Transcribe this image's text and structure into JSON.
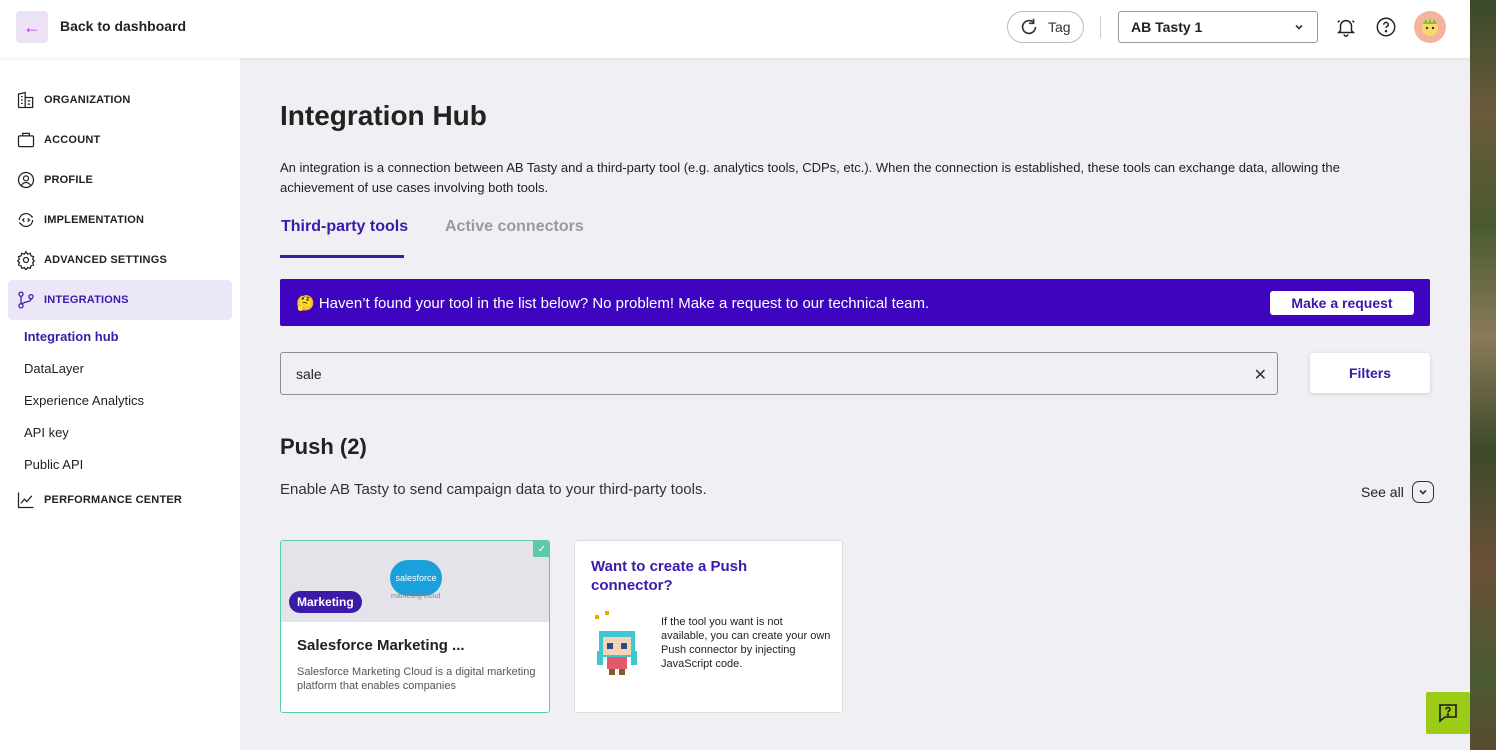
{
  "topbar": {
    "back_label": "Back to dashboard",
    "tag_label": "Tag",
    "account_name": "AB Tasty 1"
  },
  "sidebar": {
    "items": [
      {
        "label": "ORGANIZATION",
        "icon": "building-icon"
      },
      {
        "label": "ACCOUNT",
        "icon": "briefcase-icon"
      },
      {
        "label": "PROFILE",
        "icon": "user-circle-icon"
      },
      {
        "label": "IMPLEMENTATION",
        "icon": "sync-code-icon"
      },
      {
        "label": "ADVANCED SETTINGS",
        "icon": "gear-icon"
      },
      {
        "label": "INTEGRATIONS",
        "icon": "git-branch-icon",
        "active": true
      },
      {
        "label": "PERFORMANCE CENTER",
        "icon": "chart-line-icon"
      }
    ],
    "subitems": [
      {
        "label": "Integration hub",
        "active": true
      },
      {
        "label": "DataLayer"
      },
      {
        "label": "Experience Analytics"
      },
      {
        "label": "API key"
      },
      {
        "label": "Public API"
      }
    ]
  },
  "main": {
    "title": "Integration Hub",
    "description": "An integration is a connection between AB Tasty and a third-party tool (e.g. analytics tools, CDPs, etc.). When the connection is established, these tools can exchange data, allowing the achievement of use cases involving both tools.",
    "tabs": [
      {
        "label": "Third-party tools",
        "active": true
      },
      {
        "label": "Active connectors"
      }
    ],
    "banner": {
      "text": "🤔 Haven’t found your tool in the list below? No problem! Make a request to our technical team.",
      "button": "Make a request"
    },
    "search": {
      "value": "sale"
    },
    "filters_label": "Filters",
    "section": {
      "title": "Push (2)",
      "description": "Enable AB Tasty to send campaign data to your third-party tools.",
      "see_all": "See all"
    },
    "cards": [
      {
        "category": "Marketing",
        "title": "Salesforce Marketing ...",
        "description": "Salesforce Marketing Cloud is a digital marketing platform that enables companies",
        "logo_text": "salesforce",
        "logo_sub": "marketing cloud",
        "connected": true
      }
    ],
    "push_card": {
      "title": "Want to create a Push connector?",
      "description": "If the tool you want is not available, you can create your own Push connector by injecting JavaScript code."
    }
  },
  "colors": {
    "accent": "#3b1aa8",
    "banner_bg": "#3f04c0",
    "connected": "#5cc9a7",
    "help_fab": "#9ccc17"
  }
}
